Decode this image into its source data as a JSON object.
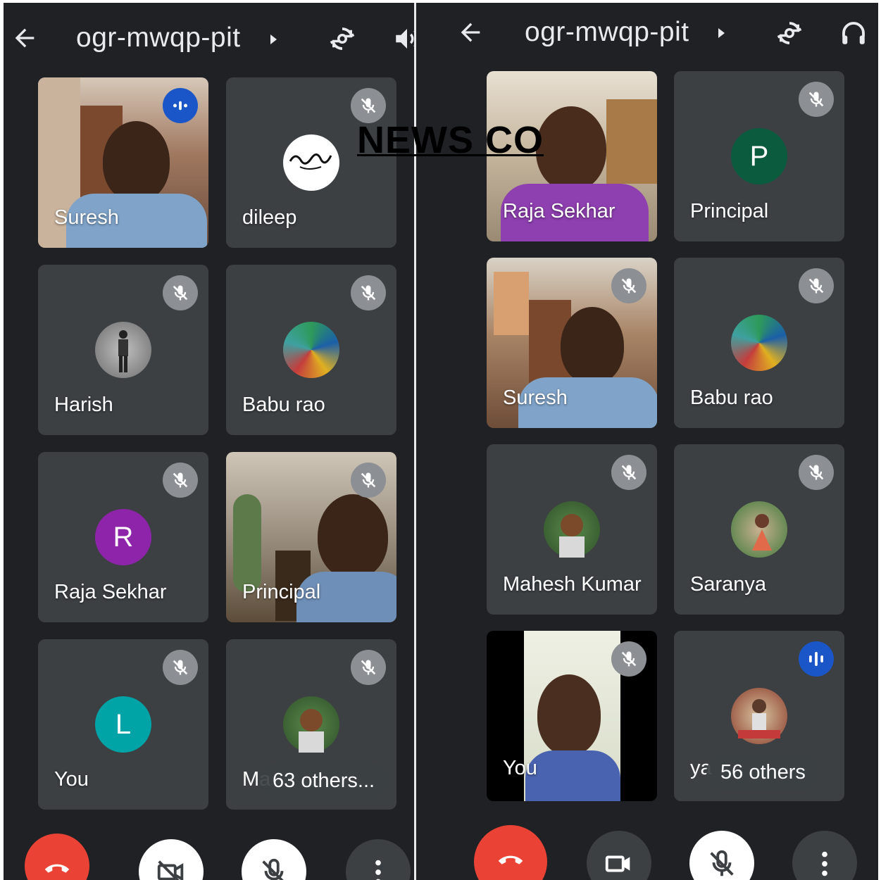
{
  "left": {
    "title": "ogr-mwqp-pit",
    "tiles": [
      {
        "name": "Suresh"
      },
      {
        "name": "dileep"
      },
      {
        "name": "Harish"
      },
      {
        "name": "Babu rao"
      },
      {
        "name": "Raja Sekhar",
        "initial": "R"
      },
      {
        "name": "Principal"
      },
      {
        "name": "You",
        "initial": "L"
      },
      {
        "name": "Ma",
        "others": "63 others",
        "ellipsis": "..."
      }
    ]
  },
  "right": {
    "title": "ogr-mwqp-pit",
    "tiles": [
      {
        "name": "Raja Sekhar"
      },
      {
        "name": "Principal",
        "initial": "P"
      },
      {
        "name": "Suresh"
      },
      {
        "name": "Babu rao"
      },
      {
        "name": "Mahesh Kumar"
      },
      {
        "name": "Saranya"
      },
      {
        "name": "You"
      },
      {
        "name": "ya",
        "others": "56 others"
      }
    ]
  },
  "watermark": "NEWS CO",
  "colors": {
    "background": "#202124",
    "tile": "#3c4043",
    "end_call": "#ea4335",
    "speaking": "#1a56c8",
    "avatar_r": "#8e24aa",
    "avatar_l": "#00a3a6",
    "avatar_p": "#0b5b3f"
  },
  "icons": [
    "back-arrow-icon",
    "caret-right-icon",
    "switch-camera-icon",
    "speaker-icon",
    "headphones-icon",
    "mic-off-icon",
    "speaking-icon",
    "end-call-icon",
    "video-off-icon",
    "video-icon",
    "more-vert-icon"
  ]
}
